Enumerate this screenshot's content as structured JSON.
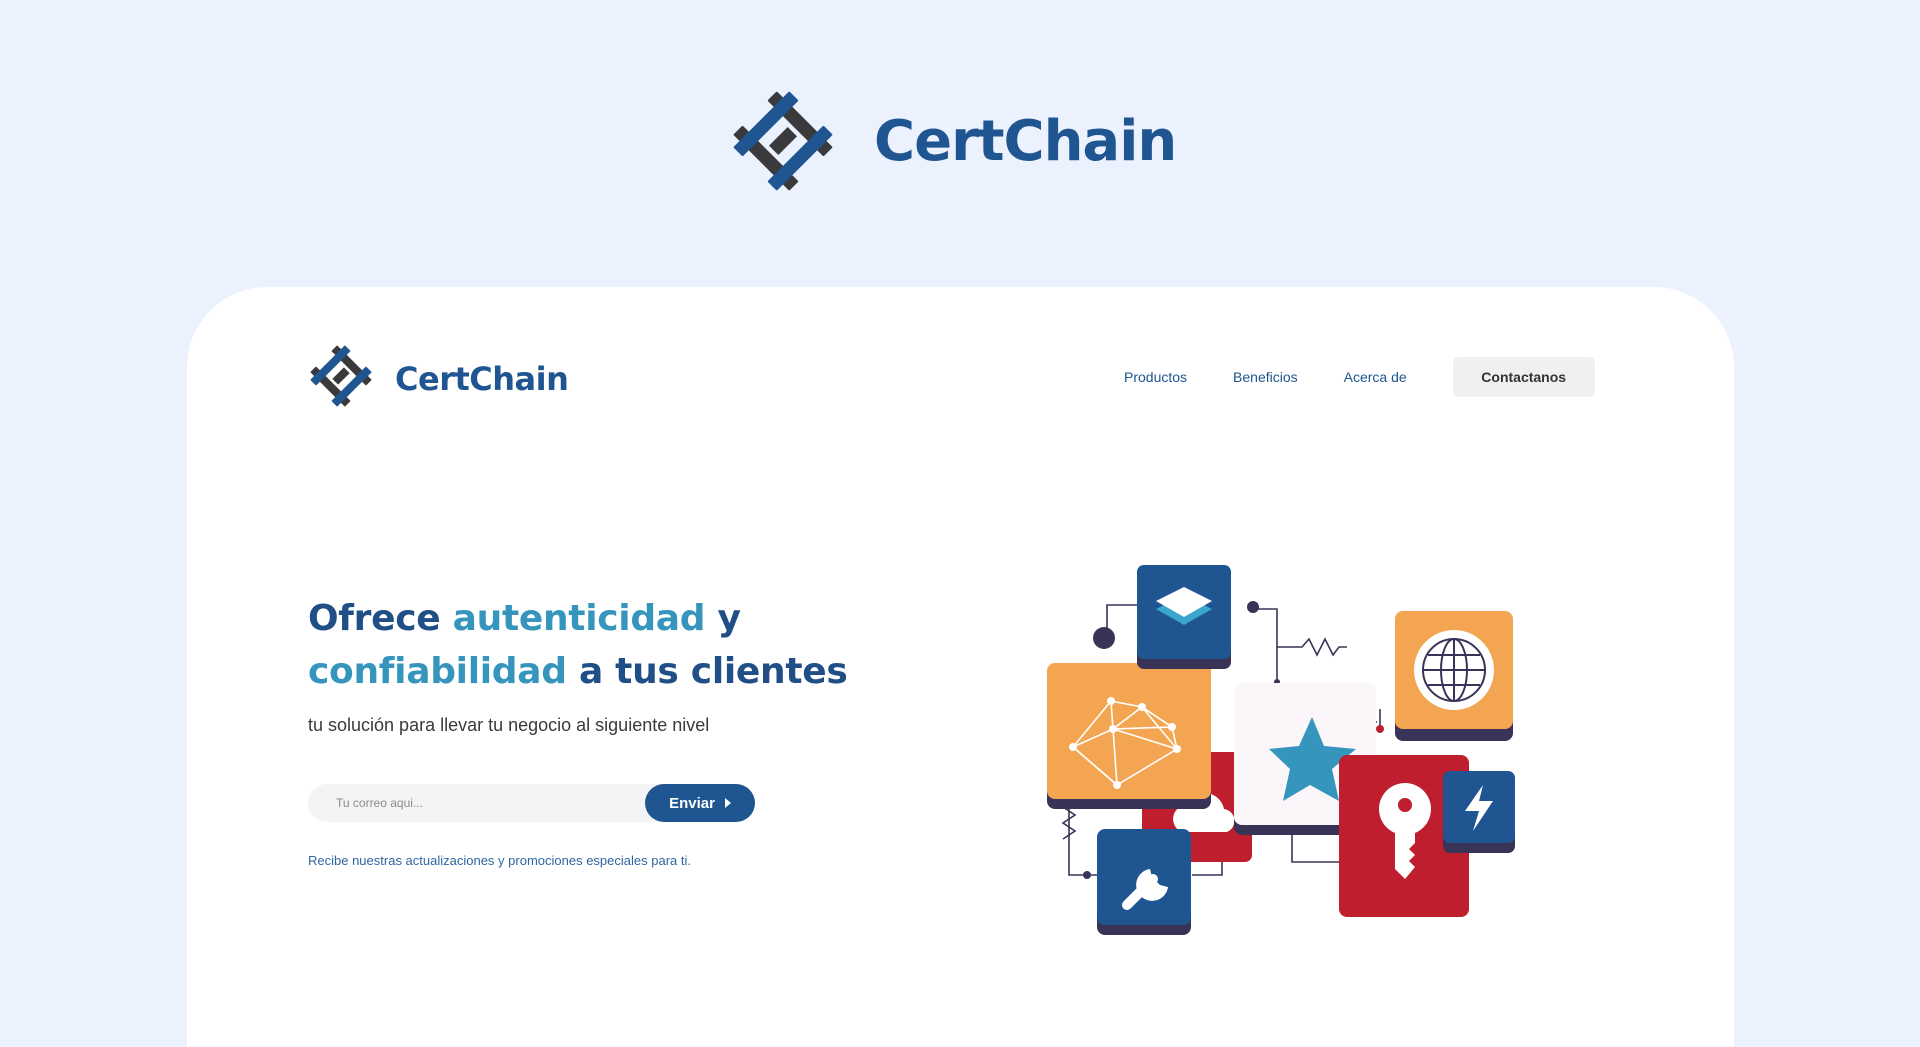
{
  "brand": {
    "name": "CertChain"
  },
  "nav": {
    "links": [
      "Productos",
      "Beneficios",
      "Acerca de"
    ],
    "cta": "Contactanos"
  },
  "hero": {
    "title_1": "Ofrece ",
    "title_2": "autenticidad",
    "title_3": " y",
    "title_4": "confiabilidad",
    "title_5": " a tus clientes",
    "subtitle": "tu solución para llevar tu negocio al siguiente nivel"
  },
  "signup": {
    "placeholder": "Tu correo aqui...",
    "button": "Enviar",
    "note": "Recibe nuestras actualizaciones y promociones especiales para ti."
  },
  "illustration": {
    "tiles": [
      "layers-icon",
      "network-icon",
      "star-icon",
      "globe-icon",
      "cloud-icon",
      "key-icon",
      "lightning-icon",
      "wrench-icon"
    ]
  },
  "colors": {
    "background": "#ebf2fe",
    "brand_blue": "#1f5590",
    "accent_teal": "#3595bd",
    "logo_dark": "#3a3a3c",
    "tile_orange": "#f3a552",
    "tile_red": "#be1e2d",
    "tile_navy": "#1f5590"
  }
}
